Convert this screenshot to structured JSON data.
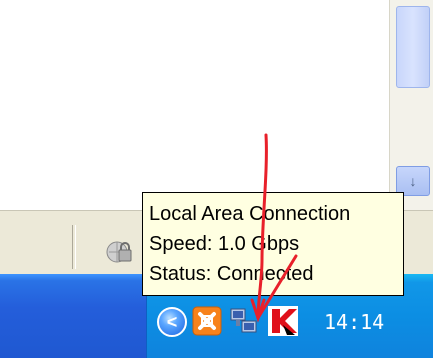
{
  "tooltip": {
    "title": "Local Area Connection",
    "speed": "Speed: 1.0 Gbps",
    "status": "Status: Connected"
  },
  "taskbar": {
    "tray": {
      "expand_button_symbol": "<",
      "icons": [
        "xampp-icon",
        "network-connection-icon",
        "kaspersky-icon"
      ],
      "clock": "14:14"
    }
  },
  "statusbar": {
    "icons": [
      "security-zone-icon"
    ]
  },
  "colors": {
    "tooltip_bg": "#ffffe1",
    "taskbar_blue": "#245edb",
    "tray_blue": "#0c8ee3",
    "annotation_red": "#e8202a"
  }
}
